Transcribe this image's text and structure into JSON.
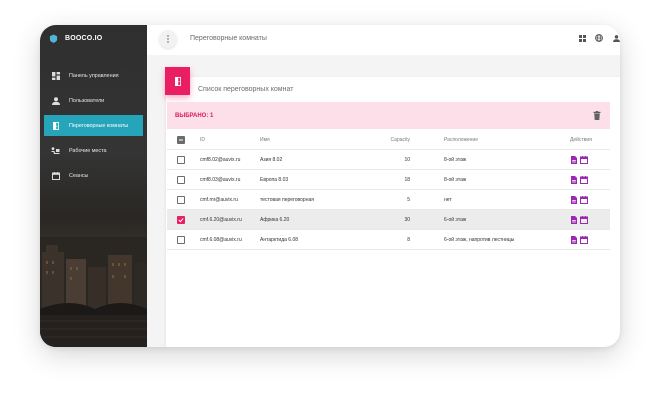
{
  "app": {
    "title": "BOOCO.IO"
  },
  "sidebar": {
    "items": [
      {
        "label": "Панель управления",
        "icon": "dashboard-icon",
        "active": false
      },
      {
        "label": "Пользователи",
        "icon": "user-icon",
        "active": false
      },
      {
        "label": "Переговорные комнаты",
        "icon": "meeting-room-icon",
        "active": true
      },
      {
        "label": "Рабочие места",
        "icon": "workplace-icon",
        "active": false
      },
      {
        "label": "Сеансы",
        "icon": "calendar-icon",
        "active": false
      }
    ]
  },
  "topbar": {
    "title": "Переговорные комнаты",
    "icons": [
      "apps-icon",
      "globe-icon",
      "account-icon"
    ]
  },
  "card": {
    "title": "Список переговорных комнат",
    "selected_label": "ВЫБРАНО: 1",
    "columns": {
      "id": "ID",
      "name": "Имя",
      "capacity": "Capacity",
      "location": "Расположение",
      "actions": "Действия"
    },
    "rows": [
      {
        "id": "cmf8.02@auvix.ru",
        "name": "Азия 8.02",
        "capacity": "10",
        "location": "8-ой этаж",
        "checked": false
      },
      {
        "id": "cmf8.03@auvix.ru",
        "name": "Европа 8.03",
        "capacity": "18",
        "location": "8-ой этаж",
        "checked": false
      },
      {
        "id": "cmf.mr@auvix.ru",
        "name": "тестовая переговорная",
        "capacity": "5",
        "location": "нет",
        "checked": false
      },
      {
        "id": "cmf.6.20@auvix.ru",
        "name": "Африка 6.20",
        "capacity": "30",
        "location": "6-ой этаж",
        "checked": true
      },
      {
        "id": "cmf.6.08@auvix.ru",
        "name": "Антарктида 6.08",
        "capacity": "8",
        "location": "6-ой этаж, напротив лестницы",
        "checked": false
      }
    ]
  },
  "colors": {
    "accent": "#26a4b9",
    "primary": "#e91e63",
    "selection_bg": "#fcdfe8",
    "action_icon": "#9c27b0"
  }
}
